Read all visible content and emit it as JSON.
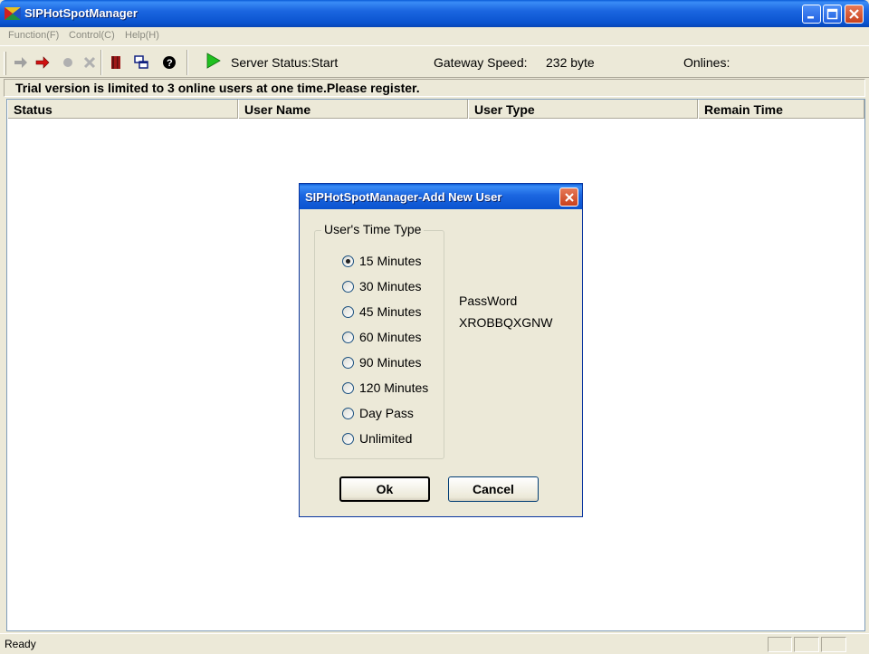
{
  "window": {
    "title": "SIPHotSpotManager"
  },
  "menu": {
    "items": [
      "Function(F)",
      "Control(C)",
      "Help(H)"
    ]
  },
  "toolbar": {
    "icons": [
      "arrow-right-icon",
      "arrow-right-red-icon",
      "stop-icon",
      "delete-icon",
      "book-icon",
      "windows-icon",
      "help-icon",
      "play-icon"
    ],
    "server_status": "Server Status:Start",
    "gateway_label": "Gateway Speed:",
    "gateway_value": "232 byte",
    "onlines_label": "Onlines:"
  },
  "notice": "Trial version is limited to 3 online users at one time.Please register.",
  "list": {
    "columns": [
      "Status",
      "User Name",
      "User Type",
      "Remain Time"
    ]
  },
  "status": {
    "text": "Ready"
  },
  "dialog": {
    "title": "SIPHotSpotManager-Add New User",
    "group_label": "User's Time Type",
    "options": [
      {
        "label": "15 Minutes",
        "selected": true
      },
      {
        "label": "30 Minutes",
        "selected": false
      },
      {
        "label": "45 Minutes",
        "selected": false
      },
      {
        "label": "60 Minutes",
        "selected": false
      },
      {
        "label": "90 Minutes",
        "selected": false
      },
      {
        "label": "120 Minutes",
        "selected": false
      },
      {
        "label": "Day Pass",
        "selected": false
      },
      {
        "label": "Unlimited",
        "selected": false
      }
    ],
    "password_label": "PassWord",
    "password_value": "XROBBQXGNW",
    "ok_label": "Ok",
    "cancel_label": "Cancel"
  },
  "colors": {
    "titlebar": "#1b66e0",
    "close": "#c8401c",
    "face": "#ece9d8"
  }
}
